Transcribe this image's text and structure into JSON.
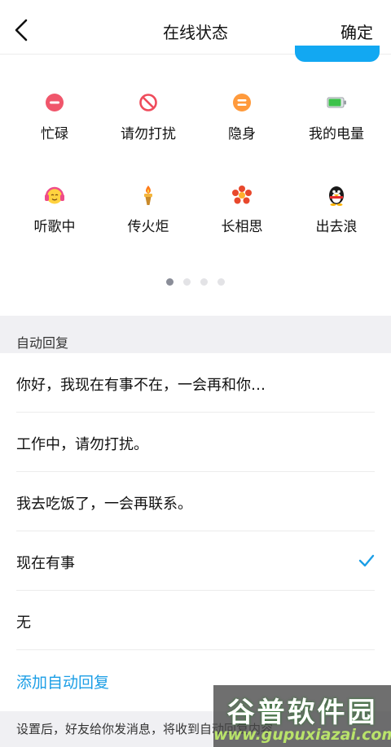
{
  "nav": {
    "title": "在线状态",
    "confirm_label": "确定"
  },
  "statuses": [
    {
      "label": "忙碌",
      "icon": "busy-minus-icon"
    },
    {
      "label": "请勿打扰",
      "icon": "do-not-disturb-icon"
    },
    {
      "label": "隐身",
      "icon": "invisible-icon"
    },
    {
      "label": "我的电量",
      "icon": "battery-icon"
    },
    {
      "label": "听歌中",
      "icon": "headphones-face-icon"
    },
    {
      "label": "传火炬",
      "icon": "torch-icon"
    },
    {
      "label": "长相思",
      "icon": "flower-icon"
    },
    {
      "label": "出去浪",
      "icon": "penguin-icon"
    }
  ],
  "pager": {
    "pages": 4,
    "current": 1
  },
  "auto_reply": {
    "section_title": "自动回复",
    "options": [
      {
        "text": "你好，我现在有事不在，一会再和你…",
        "selected": false
      },
      {
        "text": "工作中，请勿打扰。",
        "selected": false
      },
      {
        "text": "我去吃饭了，一会再联系。",
        "selected": false
      },
      {
        "text": "现在有事",
        "selected": true
      },
      {
        "text": "无",
        "selected": false
      }
    ],
    "add_label": "添加自动回复",
    "footer_note": "设置后，好友给你发消息，将收到自动回复内容"
  },
  "watermark": {
    "title": "谷普软件园",
    "url": "www.gupuxiazai.com"
  },
  "colors": {
    "accent": "#1b9ee6",
    "busy": "#f0566b",
    "dnd": "#ef4b5b",
    "invisible": "#ff9a3c"
  }
}
